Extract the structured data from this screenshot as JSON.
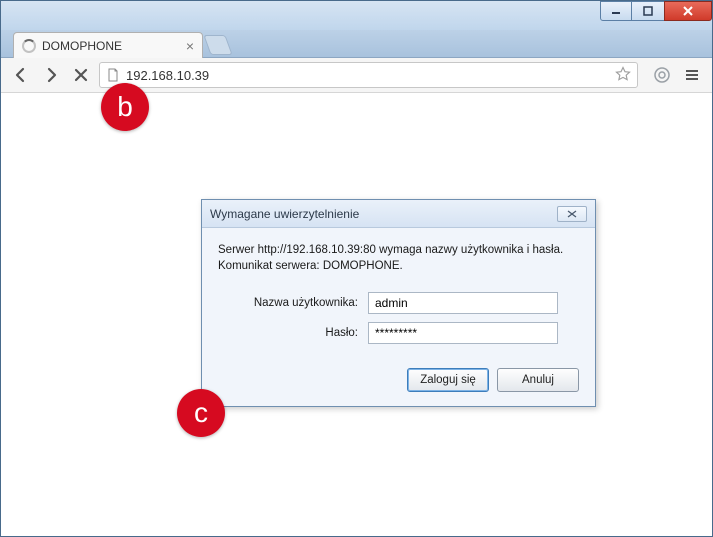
{
  "window": {
    "minimize": "–",
    "maximize": "□",
    "close": "×"
  },
  "tab": {
    "title": "DOMOPHONE",
    "close": "×"
  },
  "toolbar": {
    "url": "192.168.10.39"
  },
  "dialog": {
    "title": "Wymagane uwierzytelnienie",
    "close": "✕",
    "message": "Serwer http://192.168.10.39:80 wymaga nazwy użytkownika i hasła. Komunikat serwera: DOMOPHONE.",
    "username_label": "Nazwa użytkownika:",
    "username_value": "admin",
    "password_label": "Hasło:",
    "password_value": "*********",
    "login_label": "Zaloguj się",
    "cancel_label": "Anuluj"
  },
  "annotations": {
    "b": "b",
    "c": "c"
  }
}
